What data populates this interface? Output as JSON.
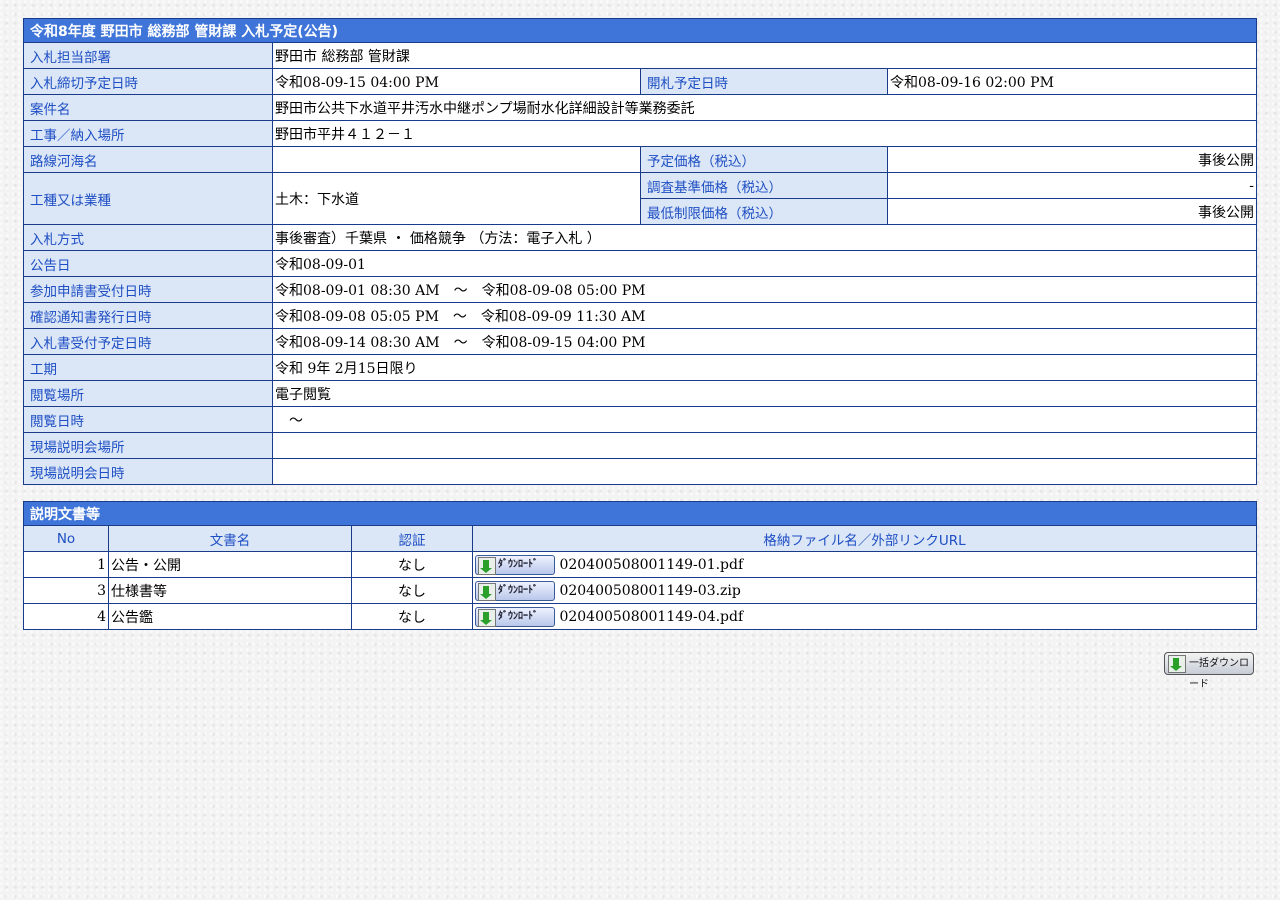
{
  "info": {
    "title": "令和8年度 野田市 総務部 管財課 入札予定(公告)",
    "rows": {
      "dept": {
        "label": "入札担当部署",
        "value": "野田市 総務部 管財課"
      },
      "deadline": {
        "label": "入札締切予定日時",
        "value": "令和08-09-15 04:00 PM"
      },
      "opening": {
        "label": "開札予定日時",
        "value": "令和08-09-16 02:00 PM"
      },
      "case_name": {
        "label": "案件名",
        "value": "野田市公共下水道平井汚水中継ポンプ場耐水化詳細設計等業務委託"
      },
      "place": {
        "label": "工事／納入場所",
        "value": "野田市平井４１２－１"
      },
      "route": {
        "label": "路線河海名",
        "value": ""
      },
      "planned_price": {
        "label": "予定価格（税込）",
        "value": "事後公開"
      },
      "survey_price": {
        "label": "調査基準価格（税込）",
        "value": "-"
      },
      "min_price": {
        "label": "最低制限価格（税込）",
        "value": "事後公開"
      },
      "category": {
        "label": "工種又は業種",
        "value": "土木：下水道"
      },
      "method": {
        "label": "入札方式",
        "value": "事後審査）千葉県 ・ 価格競争 （方法：電子入札 ）"
      },
      "notice_date": {
        "label": "公告日",
        "value": "令和08-09-01"
      },
      "application": {
        "label": "参加申請書受付日時",
        "value": "令和08-09-01 08:30 AM　～　令和08-09-08 05:00 PM"
      },
      "confirm": {
        "label": "確認通知書発行日時",
        "value": "令和08-09-08 05:05 PM　～　令和08-09-09 11:30 AM"
      },
      "bid_accept": {
        "label": "入札書受付予定日時",
        "value": "令和08-09-14 08:30 AM　～　令和08-09-15 04:00 PM"
      },
      "period": {
        "label": "工期",
        "value": "令和 9年 2月15日限り"
      },
      "view_place": {
        "label": "閲覧場所",
        "value": "電子閲覧"
      },
      "view_date": {
        "label": "閲覧日時",
        "value": "　～"
      },
      "site_place": {
        "label": "現場説明会場所",
        "value": ""
      },
      "site_date": {
        "label": "現場説明会日時",
        "value": ""
      }
    }
  },
  "docs": {
    "title": "説明文書等",
    "headers": {
      "no": "No",
      "name": "文書名",
      "auth": "認証",
      "file": "格納ファイル名／外部リンクURL"
    },
    "download_label": "ﾀﾞｳﾝﾛｰﾄﾞ",
    "items": [
      {
        "no": "1",
        "name": "公告・公開",
        "auth": "なし",
        "file": "020400508001149-01.pdf"
      },
      {
        "no": "3",
        "name": "仕様書等",
        "auth": "なし",
        "file": "020400508001149-03.zip"
      },
      {
        "no": "4",
        "name": "公告鑑",
        "auth": "なし",
        "file": "020400508001149-04.pdf"
      }
    ]
  },
  "bulk_download_label": "一括ダウンロード"
}
